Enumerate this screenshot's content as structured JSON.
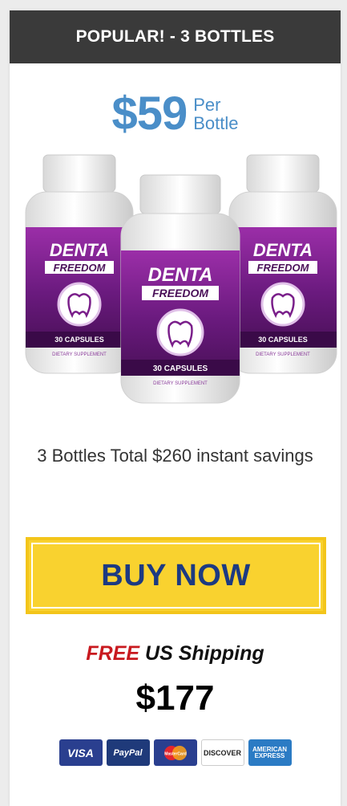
{
  "header": {
    "title": "POPULAR! - 3 BOTTLES"
  },
  "price": {
    "amount": "$59",
    "unit_line1": "Per",
    "unit_line2": "Bottle"
  },
  "product": {
    "brand_line1": "DENTA",
    "brand_line2": "FREEDOM",
    "capsules": "30 CAPSULES",
    "supplement": "DIETARY SUPPLEMENT",
    "bottle_count": 3
  },
  "savings": {
    "text": "3 Bottles Total $260 instant savings"
  },
  "cta": {
    "label": "BUY NOW"
  },
  "shipping": {
    "free": "FREE",
    "rest": "US Shipping"
  },
  "total": {
    "amount": "$177"
  },
  "payments": {
    "visa": "VISA",
    "paypal": "PayPal",
    "mastercard": "MasterCard",
    "discover": "DISCOVER",
    "amex_line1": "AMERICAN",
    "amex_line2": "EXPRESS"
  },
  "colors": {
    "header_bg": "#3a3a3a",
    "price": "#4a8ec8",
    "button_bg": "#f9d22f",
    "button_text": "#1c3a82",
    "free_text": "#c8191f",
    "label_purple": "#7a1f8a"
  }
}
